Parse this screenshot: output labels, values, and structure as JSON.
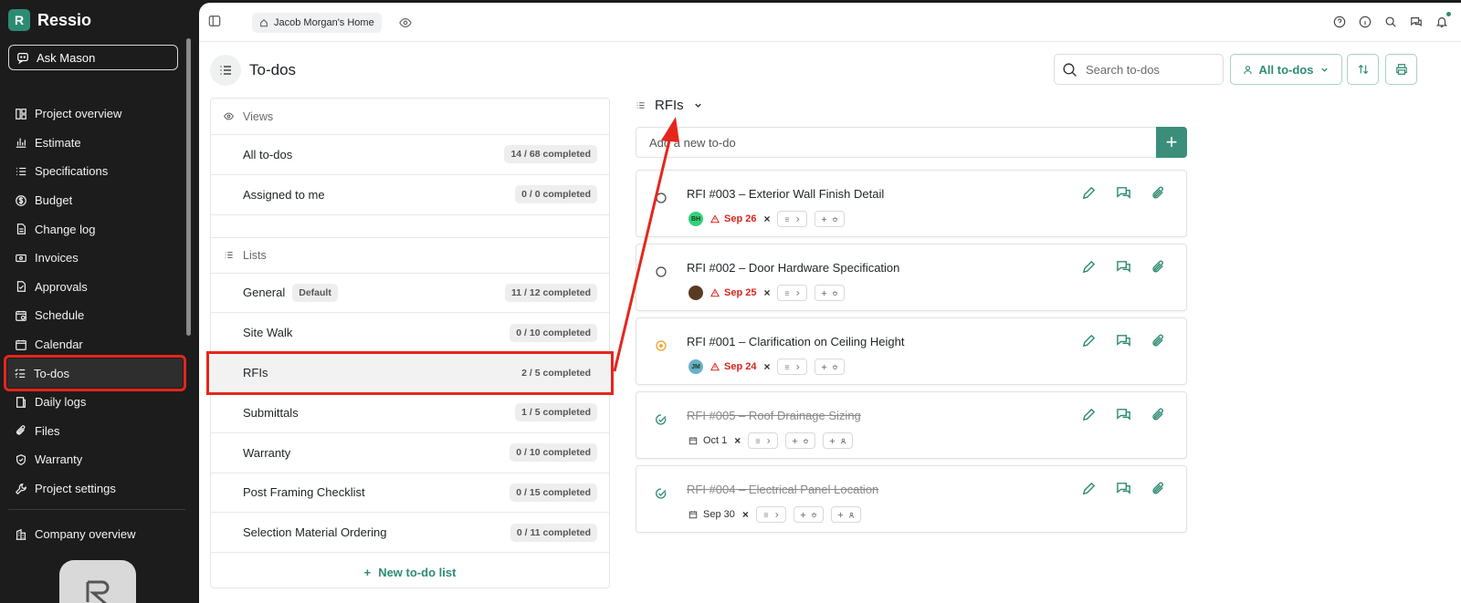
{
  "brand": {
    "name": "Ressio"
  },
  "sidebar": {
    "ask_label": "Ask Mason",
    "items": [
      {
        "label": "Project overview",
        "icon": "layout-icon"
      },
      {
        "label": "Estimate",
        "icon": "bar-chart-icon"
      },
      {
        "label": "Specifications",
        "icon": "list-icon"
      },
      {
        "label": "Budget",
        "icon": "dollar-icon"
      },
      {
        "label": "Change log",
        "icon": "document-icon"
      },
      {
        "label": "Invoices",
        "icon": "invoice-icon"
      },
      {
        "label": "Approvals",
        "icon": "approval-icon"
      },
      {
        "label": "Schedule",
        "icon": "schedule-icon"
      },
      {
        "label": "Calendar",
        "icon": "calendar-icon"
      },
      {
        "label": "To-dos",
        "icon": "checklist-icon",
        "active": true
      },
      {
        "label": "Daily logs",
        "icon": "notebook-icon"
      },
      {
        "label": "Files",
        "icon": "paperclip-icon"
      },
      {
        "label": "Warranty",
        "icon": "shield-icon"
      },
      {
        "label": "Project settings",
        "icon": "wrench-icon"
      }
    ],
    "company_label": "Company overview"
  },
  "topbar": {
    "home_label": "Jacob Morgan's Home"
  },
  "page": {
    "title": "To-dos"
  },
  "search": {
    "placeholder": "Search to-dos"
  },
  "filter": {
    "label": "All to-dos"
  },
  "views": {
    "heading": "Views",
    "rows": [
      {
        "label": "All to-dos",
        "count": "14 / 68 completed"
      },
      {
        "label": "Assigned to me",
        "count": "0 / 0 completed"
      }
    ]
  },
  "lists": {
    "heading": "Lists",
    "rows": [
      {
        "label": "General",
        "badge": "Default",
        "count": "11 / 12 completed"
      },
      {
        "label": "Site Walk",
        "count": "0 / 10 completed"
      },
      {
        "label": "RFIs",
        "count": "2 / 5 completed",
        "selected": true
      },
      {
        "label": "Submittals",
        "count": "1 / 5 completed"
      },
      {
        "label": "Warranty",
        "count": "0 / 10 completed"
      },
      {
        "label": "Post Framing Checklist",
        "count": "0 / 15 completed"
      },
      {
        "label": "Selection Material Ordering",
        "count": "0 / 11 completed"
      }
    ],
    "new_label": "New to-do list"
  },
  "detail": {
    "title": "RFIs",
    "add_placeholder": "Add a new to-do",
    "todos": [
      {
        "title": "RFI #003 – Exterior Wall Finish Detail",
        "status": "open",
        "avatar": "BH",
        "avatar_color": "#33d17a",
        "due": "Sep 26"
      },
      {
        "title": "RFI #002 – Door Hardware Specification",
        "status": "open",
        "avatar": "",
        "avatar_color": "#5a3a22",
        "due": "Sep 25"
      },
      {
        "title": "RFI #001 – Clarification on Ceiling Height",
        "status": "in-progress",
        "avatar": "JM",
        "avatar_color": "#6ab0c8",
        "due": "Sep 24"
      },
      {
        "title": "RFI #005 – Roof Drainage Sizing",
        "status": "done",
        "date": "Oct 1"
      },
      {
        "title": "RFI #004 – Electrical Panel Location",
        "status": "done",
        "date": "Sep 30"
      }
    ]
  },
  "colors": {
    "accent": "#2e8b73",
    "highlight": "#e5261c",
    "danger": "#d9251c",
    "sidebar_bg": "#1c1c1c"
  }
}
